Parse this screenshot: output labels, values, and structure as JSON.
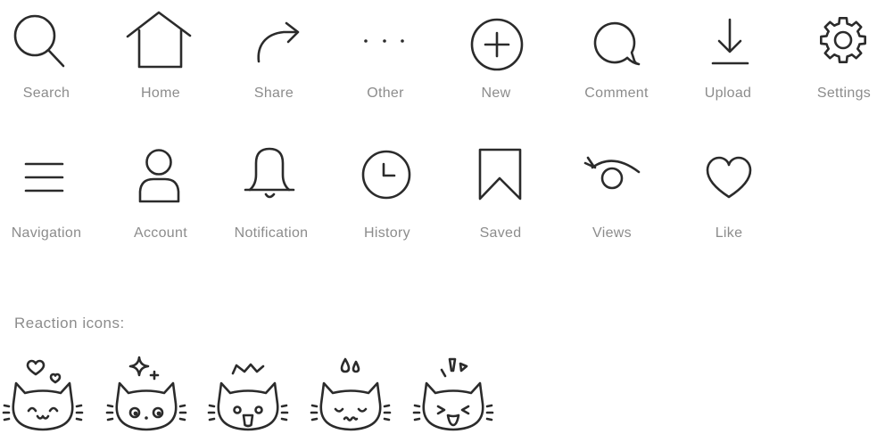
{
  "icon_set": {
    "rows": [
      [
        {
          "label": "Search",
          "icon": "search-icon"
        },
        {
          "label": "Home",
          "icon": "home-icon"
        },
        {
          "label": "Share",
          "icon": "share-arrow-icon"
        },
        {
          "label": "Other",
          "icon": "more-dots-icon"
        },
        {
          "label": "New",
          "icon": "plus-circle-icon"
        },
        {
          "label": "Comment",
          "icon": "comment-bubble-icon"
        },
        {
          "label": "Upload",
          "icon": "arrow-down-to-line-icon"
        },
        {
          "label": "Settings",
          "icon": "gear-icon"
        }
      ],
      [
        {
          "label": "Navigation",
          "icon": "hamburger-menu-icon"
        },
        {
          "label": "Account",
          "icon": "user-icon"
        },
        {
          "label": "Notification",
          "icon": "bell-icon"
        },
        {
          "label": "History",
          "icon": "clock-icon"
        },
        {
          "label": "Saved",
          "icon": "bookmark-icon"
        },
        {
          "label": "Views",
          "icon": "eye-icon"
        },
        {
          "label": "Like",
          "icon": "heart-icon"
        }
      ]
    ]
  },
  "reactions": {
    "heading": "Reaction icons:",
    "items": [
      {
        "icon": "cat-love-icon"
      },
      {
        "icon": "cat-starstruck-icon"
      },
      {
        "icon": "cat-shocked-icon"
      },
      {
        "icon": "cat-sweat-icon"
      },
      {
        "icon": "cat-laughing-icon"
      }
    ]
  },
  "colors": {
    "background": "#ffffff",
    "icon_stroke": "#2b2b2b",
    "label_text": "#8c8c8c"
  }
}
